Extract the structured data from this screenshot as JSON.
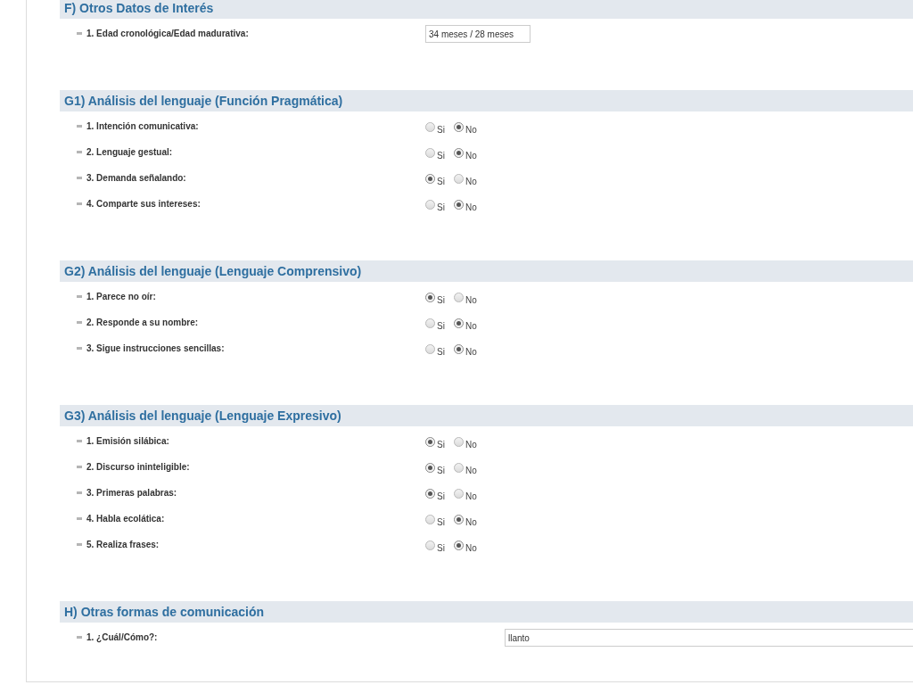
{
  "sections": [
    {
      "title": "F) Otros Datos de Interés",
      "items": [
        {
          "label": "1. Edad cronológica/Edad madurativa:",
          "kind": "short-text",
          "value": "34 meses / 28 meses"
        }
      ]
    },
    {
      "title": "G1) Análisis del lenguaje (Función Pragmática)",
      "items": [
        {
          "label": "1. Intención comunicativa:",
          "kind": "radio",
          "options": [
            {
              "label": "Si",
              "selected": false
            },
            {
              "label": "No",
              "selected": true
            }
          ]
        },
        {
          "label": "2. Lenguaje gestual:",
          "kind": "radio",
          "options": [
            {
              "label": "Si",
              "selected": false
            },
            {
              "label": "No",
              "selected": true
            }
          ]
        },
        {
          "label": "3. Demanda señalando:",
          "kind": "radio",
          "options": [
            {
              "label": "Si",
              "selected": true
            },
            {
              "label": "No",
              "selected": false
            }
          ]
        },
        {
          "label": "4. Comparte sus intereses:",
          "kind": "radio",
          "options": [
            {
              "label": "Si",
              "selected": false
            },
            {
              "label": "No",
              "selected": true
            }
          ]
        }
      ]
    },
    {
      "title": "G2) Análisis del lenguaje (Lenguaje Comprensivo)",
      "items": [
        {
          "label": "1. Parece no oír:",
          "kind": "radio",
          "options": [
            {
              "label": "Si",
              "selected": true
            },
            {
              "label": "No",
              "selected": false
            }
          ]
        },
        {
          "label": "2. Responde a su nombre:",
          "kind": "radio",
          "options": [
            {
              "label": "Si",
              "selected": false
            },
            {
              "label": "No",
              "selected": true
            }
          ]
        },
        {
          "label": "3. Sigue instrucciones sencillas:",
          "kind": "radio",
          "options": [
            {
              "label": "Si",
              "selected": false
            },
            {
              "label": "No",
              "selected": true
            }
          ]
        }
      ]
    },
    {
      "title": "G3) Análisis del lenguaje (Lenguaje Expresivo)",
      "items": [
        {
          "label": "1. Emisión silábica:",
          "kind": "radio",
          "options": [
            {
              "label": "Si",
              "selected": true
            },
            {
              "label": "No",
              "selected": false
            }
          ]
        },
        {
          "label": "2. Discurso ininteligible:",
          "kind": "radio",
          "options": [
            {
              "label": "Si",
              "selected": true
            },
            {
              "label": "No",
              "selected": false
            }
          ]
        },
        {
          "label": "3. Primeras palabras:",
          "kind": "radio",
          "options": [
            {
              "label": "Si",
              "selected": true
            },
            {
              "label": "No",
              "selected": false
            }
          ]
        },
        {
          "label": "4. Habla ecolática:",
          "kind": "radio",
          "options": [
            {
              "label": "Si",
              "selected": false
            },
            {
              "label": "No",
              "selected": true
            }
          ]
        },
        {
          "label": "5. Realiza frases:",
          "kind": "radio",
          "options": [
            {
              "label": "Si",
              "selected": false
            },
            {
              "label": "No",
              "selected": true
            }
          ]
        }
      ]
    },
    {
      "title": "H) Otras formas de comunicación",
      "items": [
        {
          "label": "1. ¿Cuál/Cómo?:",
          "kind": "wide-text",
          "value": "llanto"
        }
      ]
    }
  ]
}
